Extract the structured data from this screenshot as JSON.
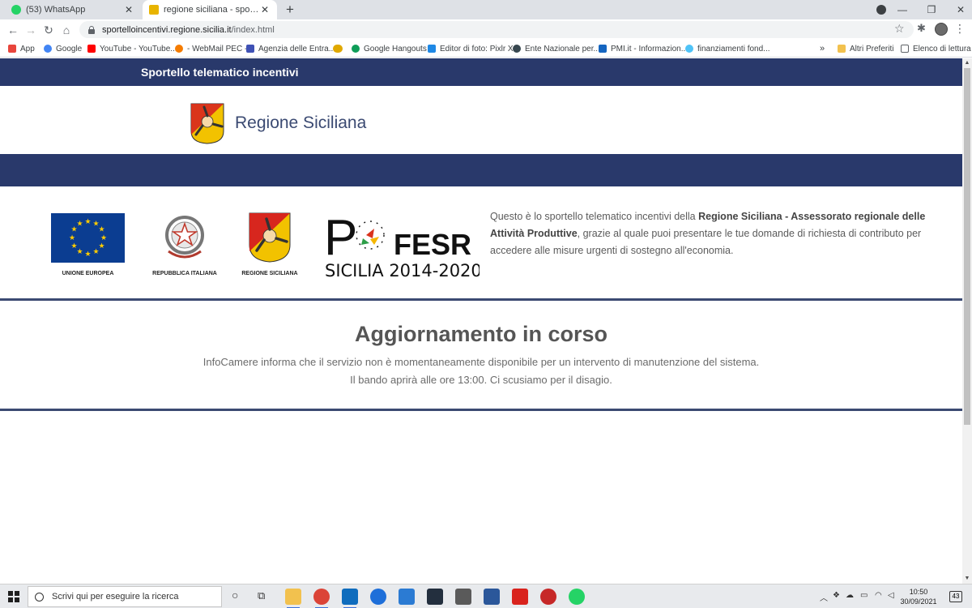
{
  "browser": {
    "tabs": [
      {
        "title": "(53) WhatsApp",
        "favicon_color": "#25d366",
        "active": false
      },
      {
        "title": "regione siciliana - sportello telem",
        "favicon_color": "#e8b400",
        "active": true
      }
    ],
    "url": {
      "host": "sportelloincentivi.regione.sicilia.it",
      "path": "/index.html"
    },
    "bookmarks": [
      {
        "label": "App",
        "icon": "apps-grid-icon",
        "color": "#e8453c"
      },
      {
        "label": "Google",
        "icon": "google-icon",
        "color": "#4285f4"
      },
      {
        "label": "YouTube - YouTube...",
        "icon": "youtube-icon",
        "color": "#ff0000"
      },
      {
        "label": "- WebMail PEC -",
        "icon": "webmail-icon",
        "color": "#f57c00"
      },
      {
        "label": "Agenzia delle Entra...",
        "icon": "agenzia-entrate-icon",
        "color": "#3f51b5"
      },
      {
        "label": "",
        "icon": "link-icon",
        "color": "#e0a800"
      },
      {
        "label": "Google Hangouts",
        "icon": "hangouts-icon",
        "color": "#0f9d58"
      },
      {
        "label": "Editor di foto: Pixlr X",
        "icon": "pixlr-icon",
        "color": "#1e88e5"
      },
      {
        "label": "Ente Nazionale per...",
        "icon": "ente-nazionale-icon",
        "color": "#37474f"
      },
      {
        "label": "PMI.it - Informazion...",
        "icon": "pmi-icon",
        "color": "#1565c0"
      },
      {
        "label": "finanziamenti fond...",
        "icon": "globe-icon",
        "color": "#4fc3f7"
      }
    ],
    "bookmarks_overflow": "»",
    "other_bookmarks": "Altri Preferiti",
    "reading_list": "Elenco di lettura"
  },
  "page": {
    "topbar_title": "Sportello telematico incentivi",
    "brand_name": "Regione Siciliana",
    "logos": [
      {
        "caption": "UNIONE EUROPEA"
      },
      {
        "caption": "REPUBBLICA ITALIANA"
      },
      {
        "caption": "REGIONE SICILIANA"
      }
    ],
    "fesr": {
      "acronym": "FESR",
      "subtitle": "SICILIA 2014-2020",
      "letter": "P"
    },
    "intro": {
      "before": "Questo è lo sportello telematico incentivi della ",
      "bold": "Regione Siciliana - Assessorato regionale delle Attività Produttive",
      "after": ", grazie al quale puoi presentare le tue domande di richiesta di contributo per accedere alle misure urgenti di sostegno all'economia."
    },
    "headline": "Aggiornamento in corso",
    "message_line1": "InfoCamere informa che il servizio non è momentaneamente disponibile per un intervento di manutenzione del sistema.",
    "message_line2": "Il bando aprirà alle ore 13:00. Ci scusiamo per il disagio."
  },
  "taskbar": {
    "search_placeholder": "Scrivi qui per eseguire la ricerca",
    "clock_time": "10:50",
    "clock_date": "30/09/2021",
    "notifications": "43",
    "apps": [
      {
        "name": "file-explorer-icon",
        "color": "#f2c14e"
      },
      {
        "name": "chrome-icon",
        "color": "#db4437"
      },
      {
        "name": "outlook-icon",
        "color": "#0f6cbd"
      },
      {
        "name": "thunderbird-icon",
        "color": "#1e6fd9"
      },
      {
        "name": "photos-icon",
        "color": "#2b7bd3"
      },
      {
        "name": "prime-video-icon",
        "color": "#232f3e"
      },
      {
        "name": "calculator-icon",
        "color": "#5a5a5a"
      },
      {
        "name": "word-icon",
        "color": "#2b579a"
      },
      {
        "name": "acrobat-icon",
        "color": "#d9231d"
      },
      {
        "name": "app-red-icon",
        "color": "#c62828"
      },
      {
        "name": "whatsapp-icon",
        "color": "#25d366"
      }
    ]
  },
  "colors": {
    "navy": "#29396b",
    "rule": "#3b4a72"
  }
}
